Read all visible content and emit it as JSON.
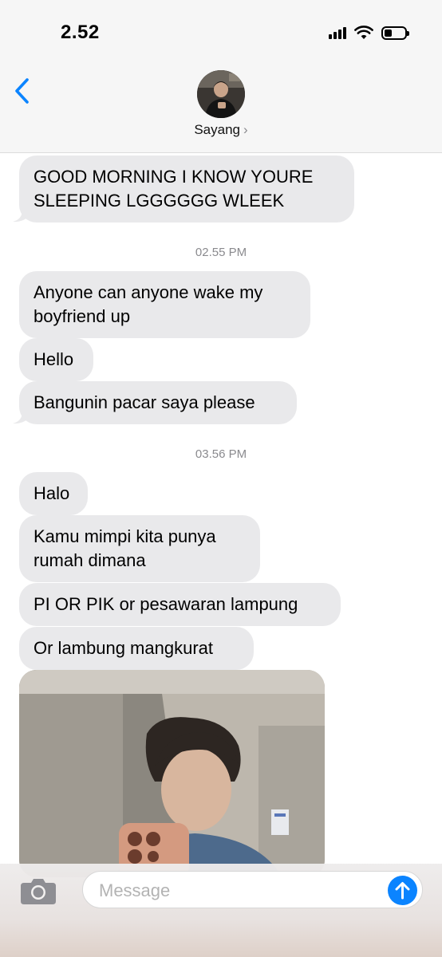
{
  "status_bar": {
    "time": "2.52",
    "icons": [
      "cellular-signal-icon",
      "wifi-icon",
      "battery-icon"
    ]
  },
  "header": {
    "back_icon": "chevron-left-icon",
    "contact_name": "Sayang",
    "contact_chevron": "›"
  },
  "colors": {
    "accent": "#0b84ff",
    "received_bubble": "#e9e9eb",
    "timestamp": "#8a8a8e"
  },
  "conversation": [
    {
      "type": "message",
      "text": "GOOD MORNING I KNOW YOURE SLEEPING LGGGGGG WLEEK"
    },
    {
      "type": "timestamp",
      "text": "02.55 PM"
    },
    {
      "type": "message",
      "text": "Anyone can anyone wake my boyfriend up"
    },
    {
      "type": "message",
      "text": "Hello"
    },
    {
      "type": "message",
      "text": "Bangunin pacar saya please"
    },
    {
      "type": "timestamp",
      "text": "03.56 PM"
    },
    {
      "type": "message",
      "text": "Halo"
    },
    {
      "type": "message",
      "text": "Kamu mimpi kita punya rumah dimana"
    },
    {
      "type": "message",
      "text": "PI OR PIK or pesawaran lampung"
    },
    {
      "type": "message",
      "text": "Or lambung mangkurat"
    },
    {
      "type": "photo",
      "icon": "photo-attachment"
    }
  ],
  "input": {
    "placeholder": "Message",
    "value": "",
    "camera_icon": "camera-icon",
    "send_icon": "arrow-up-icon"
  }
}
